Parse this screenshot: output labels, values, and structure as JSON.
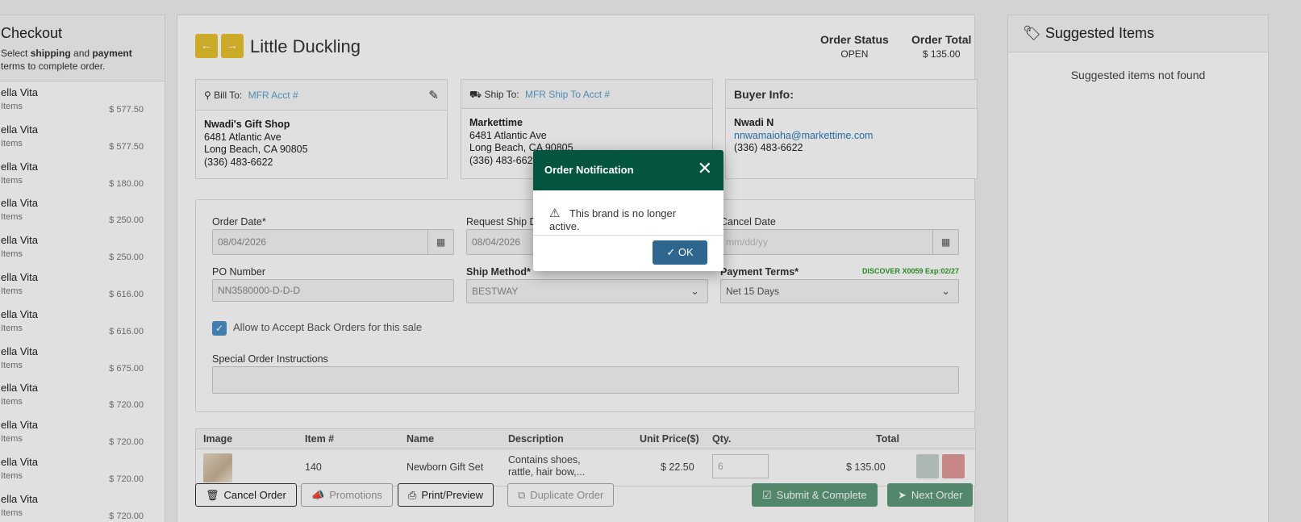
{
  "checkout": {
    "title": "Checkout",
    "subtitle_pre": "Select ",
    "subtitle_b1": "shipping",
    "subtitle_mid": " and ",
    "subtitle_b2": "payment",
    "subtitle_post": "terms to complete order.",
    "items": [
      {
        "brand": "ella Vita",
        "count": "Items",
        "amount": "$ 577.50"
      },
      {
        "brand": "ella Vita",
        "count": "Items",
        "amount": "$ 577.50"
      },
      {
        "brand": "ella Vita",
        "count": "Items",
        "amount": "$ 180.00"
      },
      {
        "brand": "ella Vita",
        "count": "Items",
        "amount": "$ 250.00"
      },
      {
        "brand": "ella Vita",
        "count": "Items",
        "amount": "$ 250.00"
      },
      {
        "brand": "ella Vita",
        "count": "Items",
        "amount": "$ 616.00"
      },
      {
        "brand": "ella Vita",
        "count": "Items",
        "amount": "$ 616.00"
      },
      {
        "brand": "ella Vita",
        "count": "Items",
        "amount": "$ 675.00"
      },
      {
        "brand": "ella Vita",
        "count": "Items",
        "amount": "$ 720.00"
      },
      {
        "brand": "ella Vita",
        "count": "Items",
        "amount": "$ 720.00"
      },
      {
        "brand": "ella Vita",
        "count": "Items",
        "amount": "$ 720.00"
      },
      {
        "brand": "ella Vita",
        "count": "Items",
        "amount": "$ 720.00"
      }
    ]
  },
  "order": {
    "brand_name": "Little Duckling",
    "status_label": "Order Status",
    "status_value": "OPEN",
    "total_label": "Order Total",
    "total_value": "$ 135.00"
  },
  "bill_to": {
    "label": "Bill To:",
    "link": "MFR Acct #",
    "name": "Nwadi's Gift Shop",
    "line1": "6481 Atlantic Ave",
    "line2": "Long Beach, CA 90805",
    "phone": "(336) 483-6622"
  },
  "ship_to": {
    "label": "Ship To:",
    "link": "MFR Ship To Acct #",
    "name": "Markettime",
    "line1": "6481 Atlantic Ave",
    "line2": "Long Beach, CA 90805",
    "phone": "(336) 483-6622"
  },
  "buyer": {
    "label": "Buyer Info:",
    "name": "Nwadi N",
    "email": "nnwamaioha@markettime.com",
    "phone": "(336) 483-6622"
  },
  "form": {
    "order_date_label": "Order Date*",
    "order_date_value": "08/04/2026",
    "request_ship_label": "Request Ship D",
    "request_ship_value": "08/04/2026",
    "cancel_date_label": "Cancel Date",
    "cancel_date_placeholder": "mm/dd/yy",
    "po_label": "PO Number",
    "po_value": "NN3580000-D-D-D",
    "ship_method_label": "Ship Method*",
    "ship_method_value": "BESTWAY",
    "payment_label": "Payment Terms*",
    "payment_value": "Net 15 Days",
    "card_hint": "DISCOVER X0059 Exp:02/27",
    "backorder_label": "Allow to Accept Back Orders for this sale",
    "instructions_label": "Special Order Instructions"
  },
  "table": {
    "headers": {
      "image": "Image",
      "item": "Item #",
      "name": "Name",
      "description": "Description",
      "unit_price": "Unit Price($)",
      "qty": "Qty.",
      "total": "Total"
    },
    "row": {
      "item": "140",
      "name": "Newborn Gift Set",
      "desc1": "Contains shoes,",
      "desc2": "rattle, hair bow,...",
      "unit_price": "$ 22.50",
      "qty": "6",
      "total": "$ 135.00"
    }
  },
  "actions": {
    "cancel": "Cancel Order",
    "promotions": "Promotions",
    "print": "Print/Preview",
    "duplicate": "Duplicate Order",
    "submit": "Submit & Complete",
    "next": "Next Order"
  },
  "suggested": {
    "title": "Suggested Items",
    "empty": "Suggested items not found"
  },
  "modal": {
    "title": "Order Notification",
    "message": "This brand is no longer active.",
    "ok": "OK"
  },
  "colors": {
    "modal_header": "#04553f",
    "ok_button": "#2e6690",
    "nav_button": "#e8c22e",
    "green_button": "#5f9a7b"
  }
}
